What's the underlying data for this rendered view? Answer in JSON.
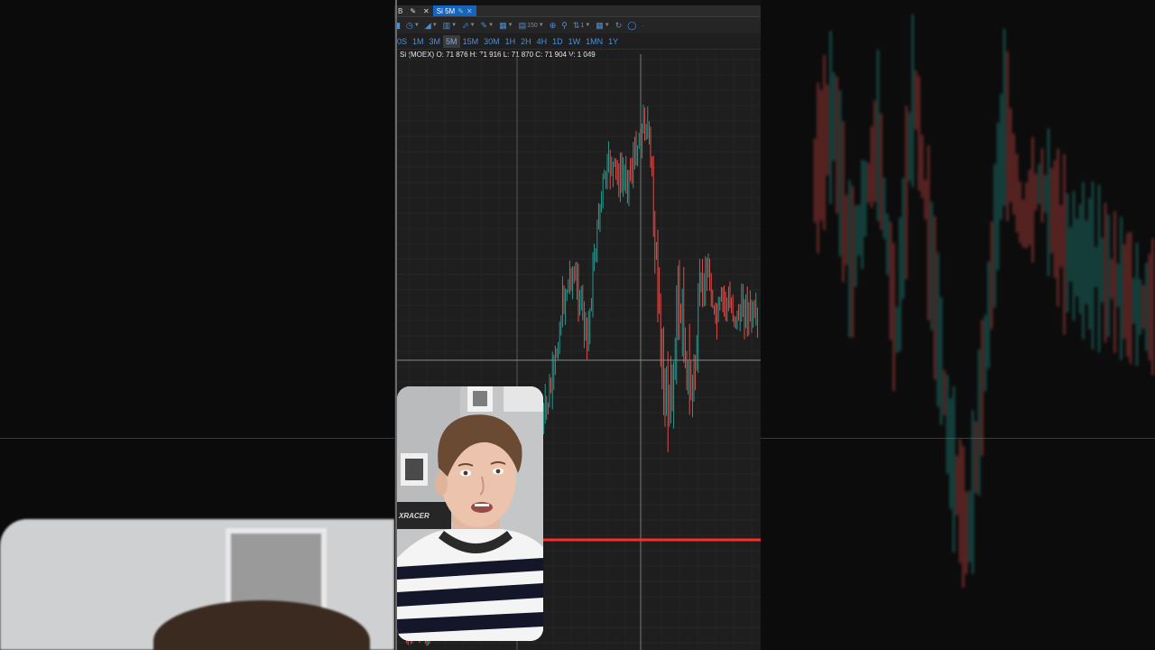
{
  "tabs": [
    {
      "label": "B"
    },
    {
      "label": "Si 5M",
      "active": true
    }
  ],
  "toolbar": {
    "bar_count": "150",
    "sort_count": "1"
  },
  "timeframes": [
    "0S",
    "1M",
    "3M",
    "5M",
    "15M",
    "30M",
    "1H",
    "2H",
    "4H",
    "1D",
    "1W",
    "1MN",
    "1Y"
  ],
  "active_timeframe": "5M",
  "ohlc_line": "Si (MOEX) O: 71 876  H: 71 916  L: 71 870  C: 71 904  V: 1 049",
  "chart_data": {
    "type": "candlestick",
    "symbol": "Si (MOEX)",
    "timeframe": "5M",
    "last_bar": {
      "open": 71876,
      "high": 71916,
      "low": 71870,
      "close": 71904,
      "volume": 1049
    },
    "up_color": "#26a69a",
    "down_color": "#ef5350",
    "level_line_color": "#ff2a2a",
    "grid": true
  },
  "webcam_brand": "XRACER",
  "colors": {
    "accent": "#1565c0",
    "link": "#4a90d9",
    "background": "#1e1e1e"
  }
}
